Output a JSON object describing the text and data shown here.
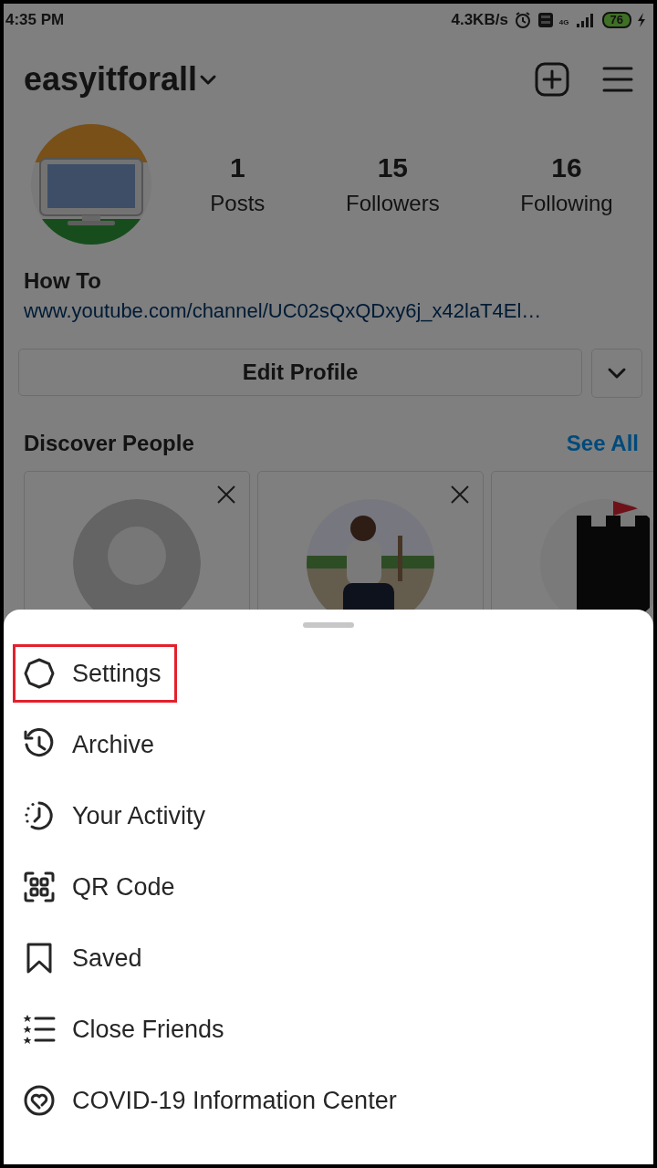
{
  "status_bar": {
    "time": "4:35 PM",
    "net_speed": "4.3KB/s",
    "network_type": "4G",
    "battery": "76",
    "charging": true
  },
  "header": {
    "username": "easyitforall"
  },
  "profile": {
    "avatar": {
      "kind": "picture"
    },
    "stats": [
      {
        "value": "1",
        "label": "Posts"
      },
      {
        "value": "15",
        "label": "Followers"
      },
      {
        "value": "16",
        "label": "Following"
      }
    ],
    "name": "How To",
    "link": "www.youtube.com/channel/UC02sQxQDxy6j_x42laT4El…"
  },
  "edit_button": "Edit Profile",
  "discover": {
    "title": "Discover People",
    "see_all": "See All",
    "cards": [
      {
        "kind": "placeholder",
        "dismissible": true
      },
      {
        "kind": "picture",
        "dismissible": true
      },
      {
        "kind": "picture"
      }
    ]
  },
  "menu": {
    "items": [
      {
        "kind": "settings",
        "label": "Settings",
        "selected": true
      },
      {
        "kind": "archive",
        "label": "Archive",
        "selected": false
      },
      {
        "kind": "activity",
        "label": "Your Activity",
        "selected": false
      },
      {
        "kind": "qr",
        "label": "QR Code",
        "selected": false
      },
      {
        "kind": "saved",
        "label": "Saved",
        "selected": false
      },
      {
        "kind": "close_friends",
        "label": "Close Friends",
        "selected": false
      },
      {
        "kind": "covid",
        "label": "COVID-19 Information Center",
        "selected": false
      }
    ]
  }
}
